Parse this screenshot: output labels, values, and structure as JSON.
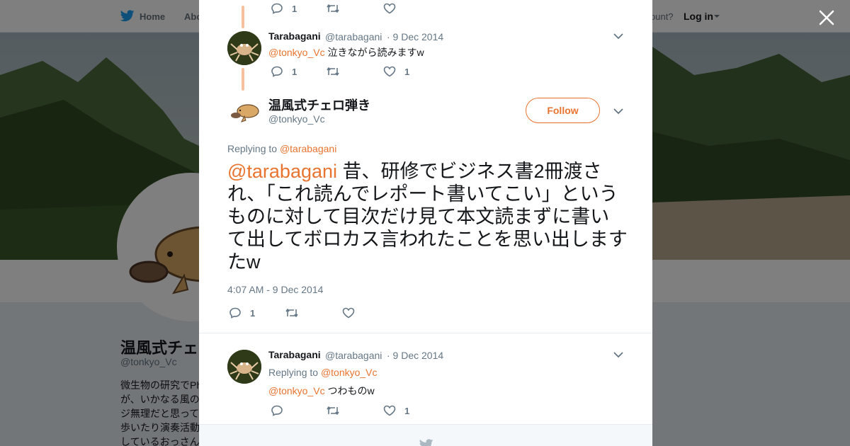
{
  "topbar": {
    "home_label": "Home",
    "about_label": "Abo",
    "account_prompt": "ccount?",
    "login_label": "Log in"
  },
  "profile": {
    "display_name": "温風式チェ",
    "handle": "@tonkyo_Vc",
    "bio_lines": [
      "微生物の研究でPh",
      "が、いかなる風の",
      "ジ無理だと思って",
      "歩いたり演奏活動",
      "しているおっさん"
    ]
  },
  "colors": {
    "accent": "#e8742f",
    "thread_line": "#f6c0a0",
    "muted": "#657786"
  },
  "modal": {
    "top_reply": {
      "reply_count": "1",
      "retweet_count": "",
      "like_count": ""
    },
    "reply1": {
      "name": "Tarabagani",
      "handle": "@tarabagani",
      "date": "· 9 Dec 2014",
      "mention": "@tonkyo_Vc",
      "text": "泣きながら読みますw",
      "reply_count": "1",
      "retweet_count": "",
      "like_count": "1",
      "avatar_icon": "crab-avatar"
    },
    "main": {
      "name": "温風式チェロ弾き",
      "handle": "@tonkyo_Vc",
      "follow_label": "Follow",
      "replying_prefix": "Replying to",
      "replying_mention": "@tarabagani",
      "mention": "@tarabagani",
      "text": " 昔、研修でビジネス書2冊渡され、「これ読んでレポート書いてこい」というものに対して目次だけ見て本文読まずに書いて出してボロカス言われたことを思い出しますたw",
      "timestamp": "4:07 AM - 9 Dec 2014",
      "reply_count": "1",
      "retweet_count": "",
      "like_count": "",
      "avatar_icon": "platypus-avatar"
    },
    "reply2": {
      "name": "Tarabagani",
      "handle": "@tarabagani",
      "date": "· 9 Dec 2014",
      "replying_prefix": "Replying to",
      "replying_mention": "@tonkyo_Vc",
      "mention": "@tonkyo_Vc",
      "text": "つわものw",
      "reply_count": "",
      "retweet_count": "",
      "like_count": "1",
      "avatar_icon": "crab-avatar"
    }
  }
}
